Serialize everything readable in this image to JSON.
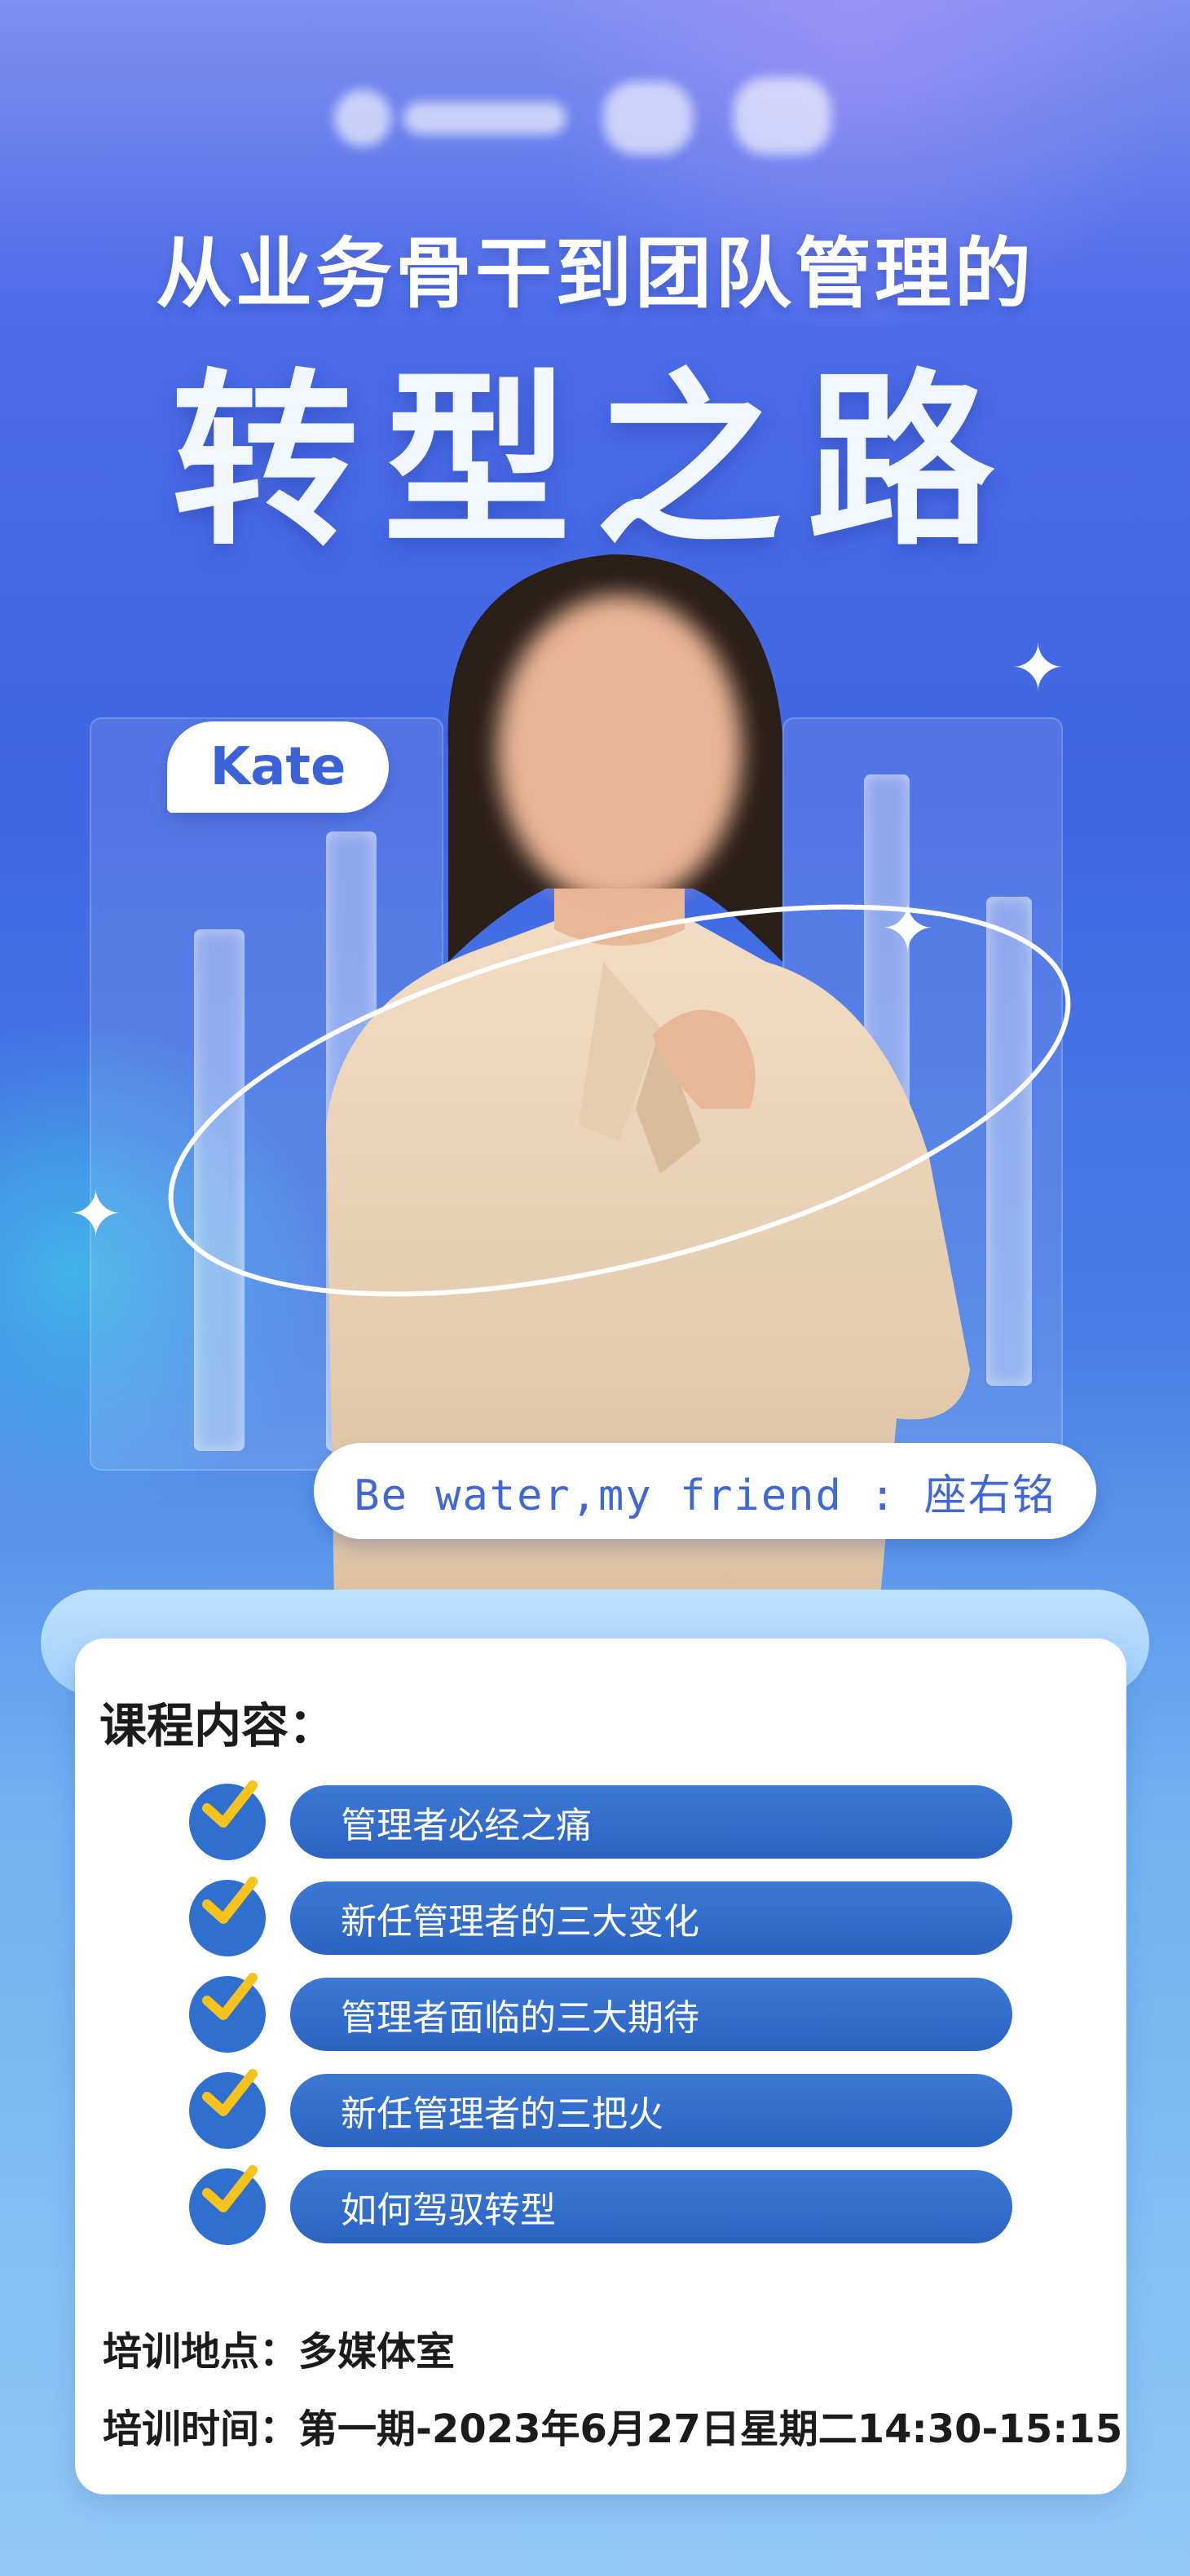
{
  "headline": "从业务骨干到团队管理的",
  "title": "转型之路",
  "speaker_name": "Kate",
  "motto": "Be water,my friend : 座右铭",
  "course": {
    "heading": "课程内容：",
    "items": [
      "管理者必经之痛",
      "新任管理者的三大变化",
      "管理者面临的三大期待",
      "新任管理者的三把火",
      "如何驾驭转型"
    ]
  },
  "location_line": "培训地点：多媒体室",
  "time_line": "培训时间：第一期-2023年6月27日星期二14:30-15:15",
  "colors": {
    "background_top": "#7f8ef0",
    "background_mid": "#3f66e2",
    "accent_blue": "#2f6fd0",
    "check_yellow": "#f6c21c",
    "card": "#ffffff"
  }
}
